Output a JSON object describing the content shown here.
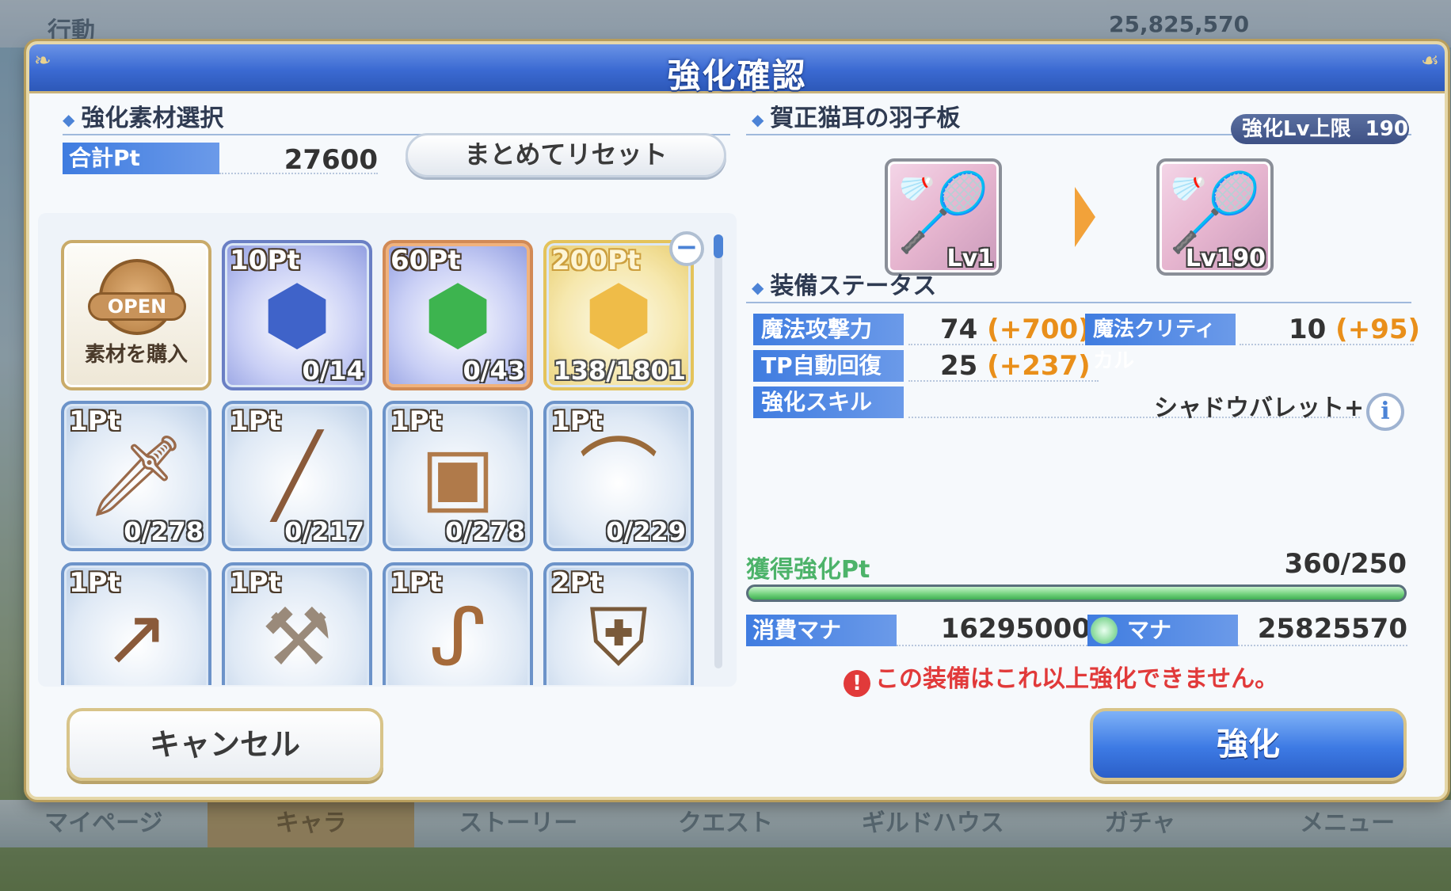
{
  "background": {
    "title": "行動",
    "money": "25,825,570",
    "nav": [
      "マイページ",
      "キャラ",
      "ストーリー",
      "クエスト",
      "ギルドハウス",
      "ガチャ",
      "メニュー"
    ]
  },
  "dialog": {
    "title": "強化確認",
    "material_section": {
      "title": "強化素材選択",
      "total_pt_label": "合計Pt",
      "total_pt_value": "27600",
      "reset_label": "まとめてリセット",
      "shop": {
        "open_label": "OPEN",
        "label": "素材を購入"
      },
      "items": [
        {
          "pt": "10Pt",
          "count": "0/14",
          "kind": "gem-blue",
          "icon": "blue-gem-icon"
        },
        {
          "pt": "60Pt",
          "count": "0/43",
          "kind": "gem-green",
          "icon": "green-gem-icon"
        },
        {
          "pt": "200Pt",
          "count": "138/1801",
          "kind": "gem-gold",
          "icon": "gold-gem-icon"
        },
        {
          "pt": "1Pt",
          "count": "0/278",
          "kind": "sword",
          "icon": "sword-icon"
        },
        {
          "pt": "1Pt",
          "count": "0/217",
          "kind": "dagger",
          "icon": "dagger-icon"
        },
        {
          "pt": "1Pt",
          "count": "0/278",
          "kind": "box",
          "icon": "chest-icon"
        },
        {
          "pt": "1Pt",
          "count": "0/229",
          "kind": "bow",
          "icon": "bow-icon"
        },
        {
          "pt": "1Pt",
          "count": "",
          "kind": "spear",
          "icon": "spear-icon"
        },
        {
          "pt": "1Pt",
          "count": "",
          "kind": "axe",
          "icon": "axe-icon"
        },
        {
          "pt": "1Pt",
          "count": "",
          "kind": "staff",
          "icon": "staff-icon"
        },
        {
          "pt": "2Pt",
          "count": "",
          "kind": "armor",
          "icon": "armor-icon"
        }
      ]
    },
    "equipment": {
      "name": "賀正猫耳の羽子板",
      "limit_label": "強化Lv上限",
      "limit_value": "190",
      "from_lv": "Lv1",
      "to_lv": "Lv190",
      "status_title": "装備ステータス",
      "stats": {
        "magic_attack": {
          "label": "魔法攻撃力",
          "value": "74",
          "plus": "(+700)"
        },
        "magic_critical": {
          "label": "魔法クリティカル",
          "value": "10",
          "plus": "(+95)"
        },
        "tp_regen": {
          "label": "TP自動回復",
          "value": "25",
          "plus": "(+237)"
        },
        "skill": {
          "label": "強化スキル",
          "value": "シャドウバレット+"
        }
      },
      "info_label": "i"
    },
    "gain": {
      "label": "獲得強化Pt",
      "value": "360/250",
      "fill_fraction": 1.0
    },
    "mana": {
      "cost_label": "消費マナ",
      "cost_value": "16295000",
      "have_label": "マナ",
      "have_value": "25825570"
    },
    "warning": "この装備はこれ以上強化できません。",
    "cancel_label": "キャンセル",
    "enhance_label": "強化"
  }
}
